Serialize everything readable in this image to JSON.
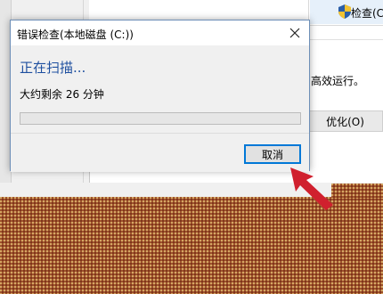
{
  "background": {
    "check_button_label": "检查(C)",
    "efficient_text": "高效运行。",
    "optimize_button_label": "优化(O)"
  },
  "dialog": {
    "title": "错误检查(本地磁盘 (C:))",
    "heading": "正在扫描...",
    "remaining": "大约剩余 26 分钟",
    "progress": 0,
    "cancel_label": "取消"
  },
  "icons": {
    "close": "close-icon",
    "shield": "shield-icon",
    "arrow": "red-arrow-icon"
  },
  "colors": {
    "heading_blue": "#1e4f9f",
    "button_border": "#0078d7",
    "arrow_red": "#d0202e",
    "texture_brown": "#a0522d"
  }
}
